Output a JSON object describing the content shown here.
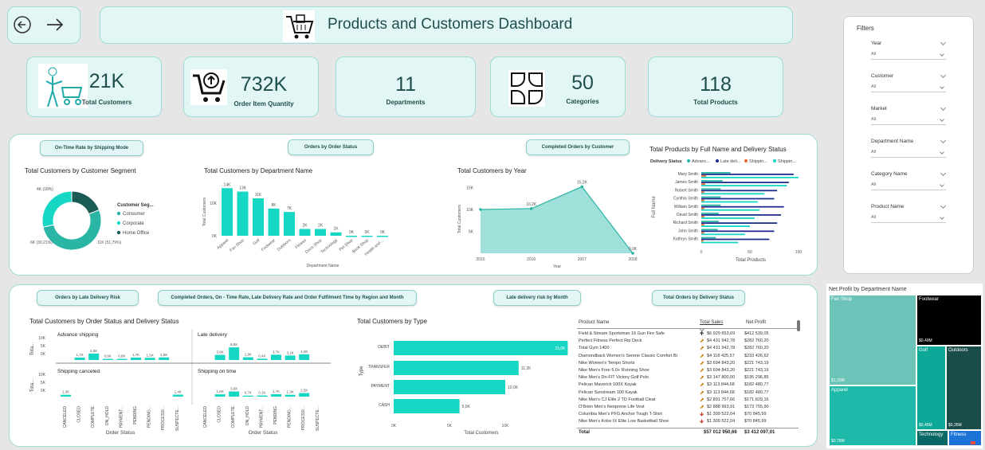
{
  "header": {
    "title": "Products and Customers Dashboard"
  },
  "kpis": [
    {
      "value": "21K",
      "label": "Total Customers",
      "icon": "shopping-cart-person-icon"
    },
    {
      "value": "732K",
      "label": "Order Item Quantity",
      "icon": "cart-upload-icon"
    },
    {
      "value": "11",
      "label": "Departments"
    },
    {
      "value": "50",
      "label": "Categories",
      "icon": "categories-grid-icon"
    },
    {
      "value": "118",
      "label": "Total Products"
    }
  ],
  "nav_top": [
    "On-Time Rate by Shipping Mode",
    "Orders by Order Status",
    "Completed Orders by Customer"
  ],
  "nav_bottom": [
    "Orders by Late Delivery Risk",
    "Completed Orders, On - Time Rate, Late Delivery Rate and Order Fulfilment Time by Region and Month",
    "Late delivery risk by Month",
    "Total Orders by Delivery Status"
  ],
  "filters": {
    "title": "Filters",
    "items": [
      {
        "label": "Year",
        "value": "All"
      },
      {
        "label": "Customer",
        "value": "All"
      },
      {
        "label": "Market",
        "value": "All"
      },
      {
        "label": "Department Name",
        "value": "All"
      },
      {
        "label": "Category Name",
        "value": "All"
      },
      {
        "label": "Product Name",
        "value": "All"
      }
    ]
  },
  "colors": {
    "teal": "#16d6c4",
    "dark": "#1a5c55",
    "mid": "#2ab5a5",
    "navy": "#1f2e8c",
    "orange": "#e56a2b"
  },
  "chart_data": [
    {
      "type": "pie",
      "title": "Total Customers by Customer Segment",
      "legend_title": "Customer Seg...",
      "categories": [
        "Consumer",
        "Corporate",
        "Home Office"
      ],
      "values": [
        11,
        6,
        4
      ],
      "labels": [
        "11K (51,79%)",
        "6K (30,21%)",
        "4K (18%)"
      ]
    },
    {
      "type": "bar",
      "title": "Total Customers by Department Name",
      "xlabel": "Department Name",
      "ylabel": "Total Customers",
      "categories": [
        "Apparel",
        "Fan Shop",
        "Golf",
        "Footwear",
        "Outdoors",
        "Fitness",
        "Discs Shop",
        "Technology",
        "Pet Shop",
        "Book Shop",
        "Health and ..."
      ],
      "values": [
        14,
        13,
        11,
        8,
        7,
        2,
        2,
        1,
        0,
        0,
        0
      ],
      "labels": [
        "14K",
        "13K",
        "11K",
        "8K",
        "7K",
        "2K",
        "2K",
        "1K",
        "0K",
        "0K",
        "0K"
      ],
      "ylim": [
        0,
        15
      ],
      "yticks": [
        "10K",
        "0K"
      ]
    },
    {
      "type": "area",
      "title": "Total Customers by Year",
      "xlabel": "Year",
      "ylabel": "Total Customers",
      "x": [
        2015,
        2016,
        2017,
        2018
      ],
      "values": [
        10.0,
        10.2,
        15.2,
        0.0
      ],
      "labels": [
        "",
        "10,2K",
        "15,2K",
        "0,0K"
      ],
      "ylim": [
        0,
        15
      ],
      "yticks": [
        "15K",
        "10K",
        "5K"
      ]
    },
    {
      "type": "bar",
      "title": "Total Products by Full Name and Delivery Status",
      "xlabel": "Total Products",
      "ylabel": "Full Name",
      "legend_title": "Delivery Status",
      "legend": [
        "Advanc...",
        "Late deli...",
        "Shippin...",
        "Shippin..."
      ],
      "categories": [
        "Mary Smith",
        "James Smith",
        "Robert Smith",
        "Cynthia Smith",
        "William Smith",
        "David Smith",
        "Richard Smith",
        "John Smith",
        "Kathryn Smith"
      ],
      "series": [
        {
          "name": "Advanc...",
          "values": [
            30,
            22,
            20,
            20,
            20,
            18,
            18,
            17,
            15
          ]
        },
        {
          "name": "Late deli...",
          "values": [
            95,
            90,
            78,
            75,
            85,
            82,
            78,
            75,
            70
          ]
        },
        {
          "name": "Shippin...",
          "values": [
            5,
            4,
            3,
            3,
            3,
            3,
            3,
            3,
            2
          ]
        },
        {
          "name": "Shippin...",
          "values": [
            100,
            88,
            65,
            58,
            60,
            55,
            50,
            45,
            38
          ]
        }
      ],
      "xlim": [
        0,
        100
      ],
      "xticks": [
        "0",
        "50",
        "100"
      ]
    },
    {
      "type": "bar",
      "title": "Total Customers by Order Status and Delivery Status",
      "xlabel": "Order Status",
      "ylabel": "Tota...",
      "categories": [
        "CANCELED",
        "CLOSED",
        "COMPLETE",
        "ON_HOLD",
        "PAYMENT...",
        "PENDING",
        "PENDING...",
        "PROCESSI...",
        "SUSPECTE..."
      ],
      "panels": [
        {
          "name": "Advance shipping",
          "values": [
            0,
            1.7,
            4.5,
            0.8,
            0.8,
            1.7,
            1.5,
            1.8,
            0
          ],
          "labels": [
            "",
            "1,7K",
            "4,5K",
            "0,8K",
            "0,8K",
            "1,7K",
            "1,5K",
            "1,8K",
            ""
          ]
        },
        {
          "name": "Late delivery",
          "values": [
            0,
            3.6,
            8.8,
            1.9,
            0.9,
            3.7,
            3.1,
            4.0,
            0
          ],
          "labels": [
            "",
            "3,6K",
            "8,8K",
            "1,9K",
            "0,4K",
            "3,7K",
            "3,1K",
            "4,0K",
            ""
          ]
        },
        {
          "name": "Shipping canceled",
          "values": [
            1.3,
            0,
            0,
            0,
            0,
            0,
            0,
            0,
            1.4
          ],
          "labels": [
            "1,3K",
            "",
            "",
            "",
            "",
            "",
            "",
            "",
            "1,4K"
          ]
        },
        {
          "name": "Shipping on time",
          "values": [
            0,
            1.6,
            3.6,
            0.7,
            0.8,
            1.7,
            1.3,
            2.5,
            0
          ],
          "labels": [
            "",
            "1,6K",
            "3,6K",
            "0,7K",
            "0,1K",
            "1,7K",
            "1,3K",
            "2,5K",
            ""
          ]
        }
      ],
      "yticks": [
        "10K",
        "5K",
        "0K"
      ]
    },
    {
      "type": "bar",
      "title": "Total Customers by Type",
      "xlabel": "Total Customers",
      "ylabel": "Type",
      "categories": [
        "DEBIT",
        "TRANSFER",
        "PAYMENT",
        "CASH"
      ],
      "values": [
        15.6,
        11.2,
        10.0,
        5.9
      ],
      "labels": [
        "15,6K",
        "11,2K",
        "10,0K",
        "5,9K"
      ],
      "xlim": [
        0,
        16
      ],
      "xticks": [
        "0K",
        "5K",
        "10K"
      ]
    },
    {
      "type": "table",
      "columns": [
        "Product Name",
        "Total Sales",
        "Net Profit"
      ],
      "rows": [
        [
          "Field & Stream Sportsman 16 Gun Fire Safe",
          "$6 929 653,69",
          "$412 539,05",
          "up"
        ],
        [
          "Perfect Fitness Perfect Rip Deck",
          "$4 431 942,78",
          "$282 760,20",
          "diag"
        ],
        [
          "Total Gym 1400",
          "$4 431 942,78",
          "$282 760,20",
          "diag"
        ],
        [
          "Diamondback Women's Serene Classic Comfort Bi",
          "$4 118 425,57",
          "$233 426,62",
          "diag"
        ],
        [
          "Nike Women's Tempo Shorts",
          "$3 694 843,20",
          "$221 743,19",
          "diag"
        ],
        [
          "Nike Men's Free 5.0+ Running Shoe",
          "$3 694 843,20",
          "$221 743,19",
          "diag"
        ],
        [
          "Nike Men's Dri-FIT Victory Golf Polo",
          "$3 147 800,00",
          "$195 296,85",
          "diag"
        ],
        [
          "Pelican Maverick 100X Kayak",
          "$3 113 844,68",
          "$182 480,77",
          "diag"
        ],
        [
          "Pelican Sunstream 100 Kayak",
          "$3 113 844,68",
          "$182 480,77",
          "diag"
        ],
        [
          "Nike Men's CJ Elite 2 TD Football Cleat",
          "$2 891 757,66",
          "$171 829,16",
          "diag"
        ],
        [
          "O'Brien Men's Neoprene Life Vest",
          "$2 888 993,91",
          "$173 755,90",
          "diag"
        ],
        [
          "Columbia Men's PFG Anchor Tough T-Shirt",
          "$1 309 522,04",
          "$70 845,99",
          "down"
        ],
        [
          "Nike Men's Kobe IX Elite Low Basketball Shoe",
          "$1 309 522,04",
          "$70 845,99",
          "down"
        ]
      ],
      "total": [
        "Total",
        "$57 012 950,66",
        "$3 412 097,01"
      ]
    },
    {
      "type": "heatmap",
      "title": "Net Profit by Department Name",
      "categories": [
        "Fan Shop",
        "Apparel",
        "Footwear",
        "Golf",
        "Outdoors",
        "Technology",
        "Fitness"
      ],
      "labels": [
        "$1,20M",
        "$0,78M",
        "$0,49M",
        "$0,45M",
        "$0,35M",
        "",
        ""
      ],
      "values": [
        1.2,
        0.78,
        0.49,
        0.45,
        0.35,
        0.1,
        0.05
      ]
    }
  ]
}
